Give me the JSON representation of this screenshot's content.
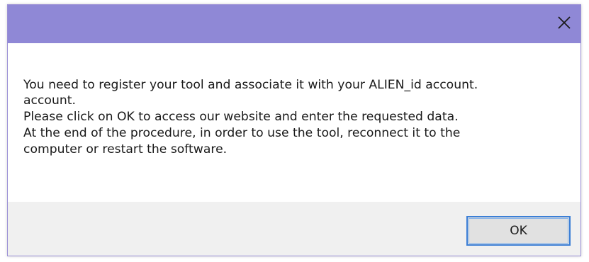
{
  "dialog": {
    "close_icon": "close-icon",
    "message_lines": [
      "You need to register your tool and associate it with your ALIEN_id account.",
      "account.",
      "Please click on OK to access our website and enter the requested data.",
      "At the end of the procedure, in order to use the tool, reconnect it to the",
      "computer or restart the software."
    ],
    "ok_label": "OK"
  },
  "colors": {
    "titlebar": "#8f88d6",
    "footer": "#f0f0f0",
    "button_border": "#3c7fd6"
  }
}
